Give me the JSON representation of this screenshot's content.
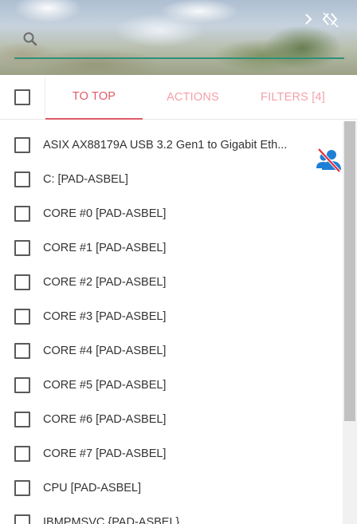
{
  "search": {
    "placeholder": ""
  },
  "tabs": [
    {
      "label": "TO TOP"
    },
    {
      "label": "ACTIONS"
    },
    {
      "label": "FILTERS [4]"
    }
  ],
  "list": {
    "items": [
      {
        "label": "ASIX AX88179A USB 3.2 Gen1 to Gigabit Eth..."
      },
      {
        "label": "C: [PAD-ASBEL]"
      },
      {
        "label": "CORE #0 [PAD-ASBEL]"
      },
      {
        "label": "CORE #1 [PAD-ASBEL]"
      },
      {
        "label": "CORE #2 [PAD-ASBEL]"
      },
      {
        "label": "CORE #3 [PAD-ASBEL]"
      },
      {
        "label": "CORE #4 [PAD-ASBEL]"
      },
      {
        "label": "CORE #5 [PAD-ASBEL]"
      },
      {
        "label": "CORE #6 [PAD-ASBEL]"
      },
      {
        "label": "CORE #7 [PAD-ASBEL]"
      },
      {
        "label": "CPU [PAD-ASBEL]"
      },
      {
        "label": "IBMPMSVC {PAD-ASBEL}"
      }
    ]
  },
  "icons": {
    "search": "search-icon",
    "collapse": "collapse-arrows-icon",
    "no_user": "user-slash-icon"
  },
  "colors": {
    "accent_underline": "#2f8f78",
    "tab_active": "#e05a68",
    "tab_inactive": "#f4a0a8",
    "icon_blue": "#1e7fd6",
    "icon_red": "#e0303a"
  }
}
